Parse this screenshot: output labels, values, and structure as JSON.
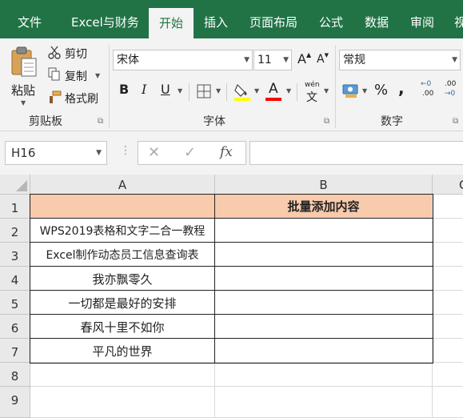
{
  "tabs": [
    {
      "label": "文件",
      "active": false
    },
    {
      "label": "Excel与财务",
      "active": false
    },
    {
      "label": "开始",
      "active": true
    },
    {
      "label": "插入",
      "active": false
    },
    {
      "label": "页面布局",
      "active": false
    },
    {
      "label": "公式",
      "active": false
    },
    {
      "label": "数据",
      "active": false
    },
    {
      "label": "审阅",
      "active": false
    },
    {
      "label": "视",
      "active": false
    }
  ],
  "ribbon": {
    "clipboard": {
      "paste_label": "粘贴",
      "cut_label": "剪切",
      "copy_label": "复制",
      "format_painter_label": "格式刷",
      "group_label": "剪贴板"
    },
    "font": {
      "font_name": "宋体",
      "font_size": "11",
      "bold": "B",
      "italic": "I",
      "underline": "U",
      "grow": "A",
      "shrink": "A",
      "font_color_glyph": "A",
      "phonetic_top": "wén",
      "phonetic_bottom": "文",
      "group_label": "字体"
    },
    "number": {
      "format": "常规",
      "percent": "%",
      "comma": ",",
      "inc_decimal_top": "←0",
      "inc_decimal_bottom": ".00",
      "dec_decimal_top": ".00",
      "dec_decimal_bottom": "→0",
      "group_label": "数字"
    }
  },
  "formula_bar": {
    "name_box": "H16",
    "cancel": "✕",
    "enter": "✓",
    "fx": "fx",
    "value": ""
  },
  "sheet": {
    "columns": [
      "A",
      "B",
      "C"
    ],
    "rows": [
      "1",
      "2",
      "3",
      "4",
      "5",
      "6",
      "7",
      "8",
      "9"
    ],
    "header_fill": "#f8cbad",
    "cells": {
      "A1": "",
      "B1": "批量添加内容",
      "A2": "WPS2019表格和文字二合一教程",
      "A3": "Excel制作动态员工信息查询表",
      "A4": "我亦飘零久",
      "A5": "一切都是最好的安排",
      "A6": "春风十里不如你",
      "A7": "平凡的世界"
    }
  },
  "colors": {
    "accent": "#217346",
    "highlight_yellow": "#ffff00",
    "font_red": "#ff0000"
  }
}
